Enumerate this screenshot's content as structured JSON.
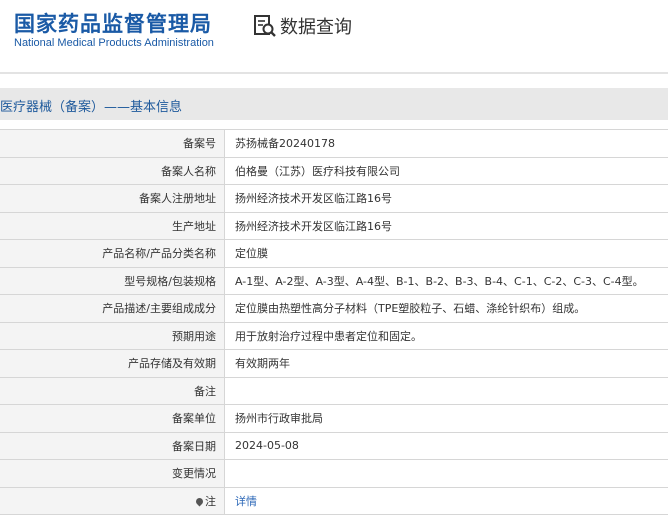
{
  "site": {
    "name_cn": "国家药品监督管理局",
    "name_en": "National Medical Products Administration",
    "query_label": "数据查询"
  },
  "section_title": "医疗器械（备案）——基本信息",
  "rows": [
    {
      "label": "备案号",
      "value": "苏扬械备20240178"
    },
    {
      "label": "备案人名称",
      "value": "伯格曼（江苏）医疗科技有限公司"
    },
    {
      "label": "备案人注册地址",
      "value": "扬州经济技术开发区临江路16号"
    },
    {
      "label": "生产地址",
      "value": "扬州经济技术开发区临江路16号"
    },
    {
      "label": "产品名称/产品分类名称",
      "value": "定位膜"
    },
    {
      "label": "型号规格/包装规格",
      "value": "A-1型、A-2型、A-3型、A-4型、B-1、B-2、B-3、B-4、C-1、C-2、C-3、C-4型。"
    },
    {
      "label": "产品描述/主要组成成分",
      "value": "定位膜由热塑性高分子材料（TPE塑胶粒子、石蜡、涤纶针织布）组成。"
    },
    {
      "label": "预期用途",
      "value": "用于放射治疗过程中患者定位和固定。"
    },
    {
      "label": "产品存储及有效期",
      "value": "有效期两年"
    },
    {
      "label": "备注",
      "value": ""
    },
    {
      "label": "备案单位",
      "value": "扬州市行政审批局"
    },
    {
      "label": "备案日期",
      "value": "2024-05-08"
    },
    {
      "label": "变更情况",
      "value": ""
    }
  ],
  "note_row": {
    "label": "注",
    "link_text": "详情"
  }
}
